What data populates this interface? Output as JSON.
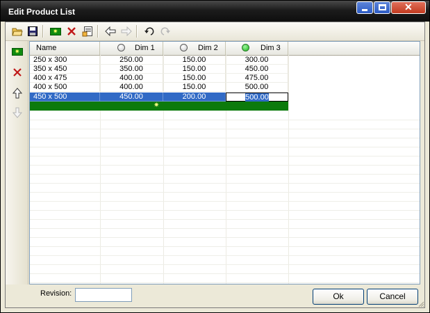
{
  "window": {
    "title": "Edit Product List"
  },
  "grid": {
    "columns": [
      {
        "label": "Name",
        "indicator": "none"
      },
      {
        "label": "Dim 1",
        "indicator": "off"
      },
      {
        "label": "Dim 2",
        "indicator": "off"
      },
      {
        "label": "Dim 3",
        "indicator": "on"
      }
    ],
    "rows": [
      {
        "name": "250 x 300",
        "dim1": "250.00",
        "dim2": "150.00",
        "dim3": "300.00"
      },
      {
        "name": "350 x 450",
        "dim1": "350.00",
        "dim2": "150.00",
        "dim3": "450.00"
      },
      {
        "name": "400 x 475",
        "dim1": "400.00",
        "dim2": "150.00",
        "dim3": "475.00"
      },
      {
        "name": "400 x 500",
        "dim1": "400.00",
        "dim2": "150.00",
        "dim3": "500.00"
      },
      {
        "name": "450 x 500",
        "dim1": "450.00",
        "dim2": "200.00",
        "dim3": "500.00"
      }
    ],
    "selected_row": 4
  },
  "footer": {
    "revision_label": "Revision:",
    "revision_value": "",
    "ok_label": "Ok",
    "cancel_label": "Cancel"
  },
  "colors": {
    "selection": "#316ac5",
    "new_row": "#0c7a0c",
    "indicator_on": "#19b819"
  },
  "icons": {
    "toolbar": [
      "open-folder-icon",
      "save-icon",
      "new-item-icon",
      "delete-icon",
      "properties-icon",
      "back-arrow-icon",
      "forward-arrow-icon",
      "undo-icon",
      "redo-icon"
    ],
    "sidebar": [
      "new-row-icon",
      "delete-row-icon",
      "move-up-icon",
      "move-down-icon"
    ]
  }
}
